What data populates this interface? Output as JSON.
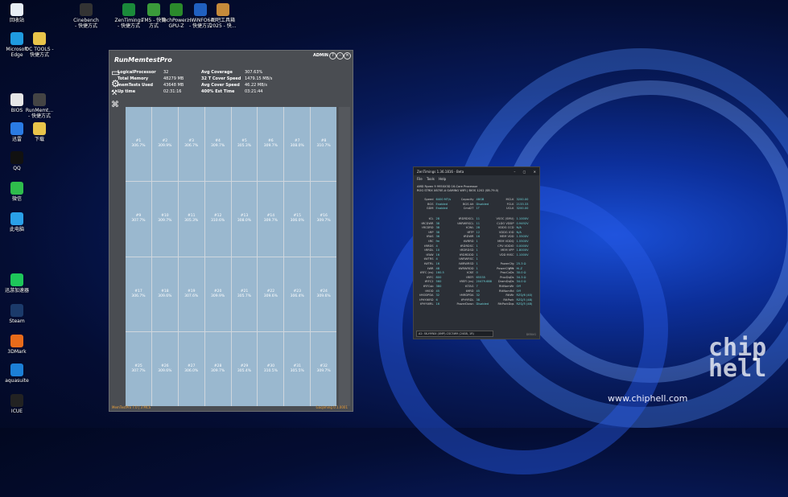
{
  "desktop_icons": [
    {
      "label": "回收站",
      "icon": "recycle-bin-icon",
      "color": "#e7eef6"
    },
    {
      "label": "Microsoft\nEdge",
      "icon": "edge-icon",
      "color": "#1f9be0"
    },
    {
      "label": "OC TOOLS -\n快捷方式",
      "icon": "folder-icon",
      "color": "#e9c44a"
    },
    {
      "label": "BIOS",
      "icon": "bios-icon",
      "color": "#e6e6e6"
    },
    {
      "label": "RunMemt...\n- 快捷方式",
      "icon": "runmemtest-icon",
      "color": "#444"
    },
    {
      "label": "迅雷",
      "icon": "thunder-icon",
      "color": "#2a7be4"
    },
    {
      "label": "下载",
      "icon": "download-folder-icon",
      "color": "#e9c44a"
    },
    {
      "label": "QQ",
      "icon": "qq-icon",
      "color": "#111"
    },
    {
      "label": "微信",
      "icon": "wechat-icon",
      "color": "#2fbd4c"
    },
    {
      "label": "此电脑",
      "icon": "this-pc-icon",
      "color": "#2aa0e8"
    },
    {
      "label": "迅游加速器",
      "icon": "booster-icon",
      "color": "#1ec75a"
    },
    {
      "label": "Steam",
      "icon": "steam-icon",
      "color": "#1b3a6a"
    },
    {
      "label": "3DMark",
      "icon": "3dmark-icon",
      "color": "#e86b1a"
    },
    {
      "label": "aquasuite",
      "icon": "aquasuite-icon",
      "color": "#1c7fd6"
    },
    {
      "label": "ICUE",
      "icon": "icue-icon",
      "color": "#222"
    },
    {
      "label": "Cinebench\n- 快捷方式",
      "icon": "cinebench-icon",
      "color": "#333"
    },
    {
      "label": "ZenTimings\n- 快捷方式",
      "icon": "zentimings-icon",
      "color": "#1a8a3a"
    },
    {
      "label": "TM5 - 快捷\n方式",
      "icon": "tm5-icon",
      "color": "#3a9a3a"
    },
    {
      "label": "TechPower...\nGPU-Z",
      "icon": "gpuz-icon",
      "color": "#2b8a2b"
    },
    {
      "label": "HWiNFO64\n- 快捷方式",
      "icon": "hwinfo-icon",
      "color": "#2060c0"
    },
    {
      "label": "图吧工具箱\n2025 - 快...",
      "icon": "toolbox-icon",
      "color": "#c58a3a"
    }
  ],
  "rmt": {
    "title": "RunMemtestPro",
    "admin": "ADMIN",
    "win_buttons": [
      "?",
      "–",
      "✕"
    ],
    "stats": [
      {
        "k": "LogicalProcessor",
        "v": "32",
        "k2": "Avg Coverage",
        "v2": "307.63%"
      },
      {
        "k": "Total Memory",
        "v": "48279 MB",
        "k2": "32 T Cover Speed",
        "v2": "1479.15 MB/s"
      },
      {
        "k": "memTests Used",
        "v": "43648 MB",
        "k2": "Avg Cover Speed",
        "v2": "46.22 MB/s"
      },
      {
        "k": "Up time",
        "v": "02:31:16",
        "k2": "400% Est Time",
        "v2": "03:21:44"
      }
    ],
    "cells": [
      [
        "#1",
        "306.7%"
      ],
      [
        "#2",
        "309.9%"
      ],
      [
        "#3",
        "306.7%"
      ],
      [
        "#4",
        "309.7%"
      ],
      [
        "#5",
        "305.3%"
      ],
      [
        "#6",
        "309.7%"
      ],
      [
        "#7",
        "308.0%"
      ],
      [
        "#8",
        "310.7%"
      ],
      [
        "#9",
        "307.7%"
      ],
      [
        "#10",
        "309.7%"
      ],
      [
        "#11",
        "305.3%"
      ],
      [
        "#12",
        "310.6%"
      ],
      [
        "#13",
        "308.0%"
      ],
      [
        "#14",
        "309.7%"
      ],
      [
        "#15",
        "306.0%"
      ],
      [
        "#16",
        "309.7%"
      ],
      [
        "#17",
        "306.7%"
      ],
      [
        "#18",
        "309.6%"
      ],
      [
        "#19",
        "307.6%"
      ],
      [
        "#20",
        "309.9%"
      ],
      [
        "#21",
        "305.7%"
      ],
      [
        "#22",
        "309.6%"
      ],
      [
        "#23",
        "306.4%"
      ],
      [
        "#24",
        "309.6%"
      ],
      [
        "#25",
        "307.7%"
      ],
      [
        "#26",
        "309.6%"
      ],
      [
        "#27",
        "306.0%"
      ],
      [
        "#28",
        "309.7%"
      ],
      [
        "#29",
        "305.4%"
      ],
      [
        "#30",
        "310.5%"
      ],
      [
        "#31",
        "305.5%"
      ],
      [
        "#32",
        "309.7%"
      ]
    ],
    "footer_left": "MemTestPro 7.0 | 3 MCS",
    "footer_right": "GaoJiming 0.1.0001"
  },
  "zt": {
    "title": "ZenTimings 1.36.1816 - Beta",
    "menu": "File Tools Help",
    "cpu": "AMD Ryzen 9 9950X3D 16-Core Processor",
    "board": "ROG STRIX X870E-A GAMING WIFI | BIOS 1202 (SB.79.0)",
    "top": [
      [
        "Speed",
        "6400 MT/s",
        "Capacity",
        "48GB",
        "MCLK",
        "3200.00"
      ],
      [
        "BGS",
        "Enabled",
        "BGS Alt",
        "Disabled",
        "FCLK",
        "2133.33"
      ],
      [
        "GDM",
        "Enabled",
        "Cmd2T",
        "1T",
        "UCLK",
        "3200.00"
      ]
    ],
    "timings": [
      [
        "tCL",
        "28",
        "tRDRDSCL",
        "11",
        "VSOC (SMU)",
        "1.1000V"
      ],
      [
        "tRCDWR",
        "38",
        "tWRWRSCL",
        "11",
        "CLDO VDDP",
        "0.9492V"
      ],
      [
        "tRCDRD",
        "38",
        "tCWL",
        "28",
        "VDDG CCD",
        "N/A"
      ],
      [
        "tRP",
        "38",
        "tRTP",
        "12",
        "VDDG IOD",
        "N/A"
      ],
      [
        "tRAS",
        "36",
        "tRDWR",
        "16",
        "MEM VDD",
        "1.5500V"
      ],
      [
        "tRC",
        "fm",
        "tWRRD",
        "1",
        "MEM VDDQ",
        "1.5500V"
      ],
      [
        "tRRDS",
        "4",
        "tRDRDSC",
        "1",
        "CPU VDDIO",
        "0.0000V"
      ],
      [
        "tRRDL",
        "10",
        "tRDRDSD",
        "1",
        "MEM VPP",
        "1.8000V"
      ],
      [
        "tFAW",
        "16",
        "tRDRDDD",
        "1",
        "VDD MISC",
        "1.1000V"
      ],
      [
        "tWTRS",
        "4",
        "tWRWRSC",
        "1",
        "",
        ""
      ],
      [
        "tWTRL",
        "16",
        "tWRWRSD",
        "1",
        "PowerCfg Pct",
        "25.3 Ω"
      ],
      [
        "tWR",
        "48",
        "tWRWRDD",
        "1",
        "PowerCfg Fr",
        "Hi-Z"
      ],
      [
        "tRFC (ns)",
        "160.5",
        "tCKE",
        "0",
        "ProcCaDs",
        "30.0 Ω"
      ],
      [
        "tRFC",
        "800",
        "tREFI",
        "65535",
        "ProcDqDs",
        "34.3 Ω"
      ],
      [
        "tRFC2",
        "560",
        "tREFI (ns)",
        "20479.688",
        "DramDqDs",
        "34.0 Ω"
      ],
      [
        "tRFCsb",
        "380",
        "tSTAG",
        "7",
        "RttNomWr",
        "Off"
      ],
      [
        "tMOD",
        "45",
        "tMRD",
        "45",
        "RttNomRd",
        "Off"
      ],
      [
        "tMODPDA",
        "32",
        "tMRDPDA",
        "32",
        "RttWr",
        "RZQ/6 (40)"
      ],
      [
        "tPHYWRD",
        "6",
        "tPHYRDL",
        "38",
        "RttPark",
        "RZQ/5 (48)"
      ],
      [
        "tPHYWRL",
        "16",
        "PowerDown",
        "Disabled",
        "RttParkDqs",
        "RZQ/5 (48)"
      ]
    ],
    "dimm": "A2: SK-HYNIX (XMP)-CSC5W9 (24GB, 1R)",
    "debug": "DEBUG"
  },
  "watermark": "www.chiphell.com",
  "chip_logo": "chip\nhell"
}
